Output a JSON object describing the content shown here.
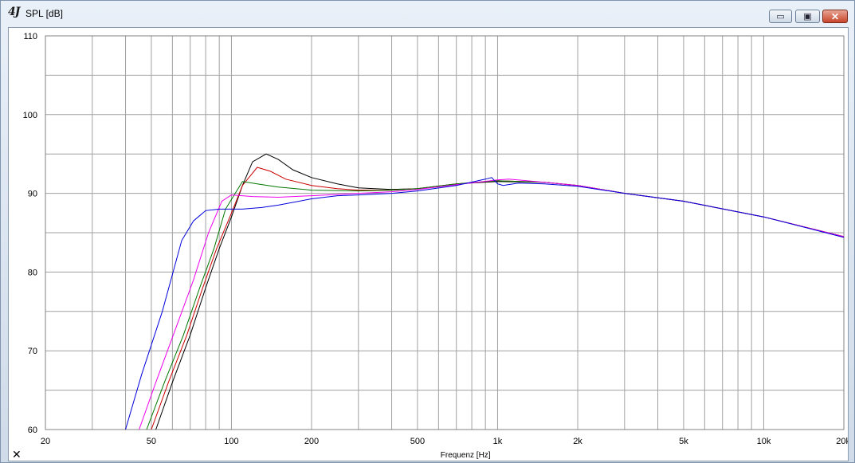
{
  "window": {
    "title": "SPL [dB]",
    "icon_glyph": "4J",
    "minimize_glyph": "▭",
    "maximize_glyph": "▣",
    "close_glyph": "✕"
  },
  "corner_glyph": "✕",
  "chart_data": {
    "type": "line",
    "xscale": "log",
    "xlim": [
      20,
      20000
    ],
    "ylim": [
      60,
      110
    ],
    "xlabel": "Frequenz [Hz]",
    "ylabel": "",
    "x_major_ticks": [
      {
        "value": 20,
        "label": "20"
      },
      {
        "value": 50,
        "label": "50"
      },
      {
        "value": 100,
        "label": "100"
      },
      {
        "value": 200,
        "label": "200"
      },
      {
        "value": 500,
        "label": "500"
      },
      {
        "value": 1000,
        "label": "1k"
      },
      {
        "value": 2000,
        "label": "2k"
      },
      {
        "value": 5000,
        "label": "5k"
      },
      {
        "value": 10000,
        "label": "10k"
      },
      {
        "value": 20000,
        "label": "20k"
      }
    ],
    "y_ticks": [
      {
        "value": 60,
        "label": "60"
      },
      {
        "value": 70,
        "label": "70"
      },
      {
        "value": 80,
        "label": "80"
      },
      {
        "value": 90,
        "label": "90"
      },
      {
        "value": 100,
        "label": "100"
      },
      {
        "value": 110,
        "label": "110"
      }
    ],
    "grid": true,
    "series": [
      {
        "color": "#000000",
        "points": [
          [
            52,
            60
          ],
          [
            60,
            66
          ],
          [
            70,
            72
          ],
          [
            80,
            78
          ],
          [
            90,
            83
          ],
          [
            100,
            87
          ],
          [
            110,
            91
          ],
          [
            120,
            94
          ],
          [
            135,
            95
          ],
          [
            150,
            94.3
          ],
          [
            170,
            93
          ],
          [
            200,
            92
          ],
          [
            250,
            91.2
          ],
          [
            300,
            90.7
          ],
          [
            400,
            90.5
          ],
          [
            500,
            90.6
          ],
          [
            700,
            91.2
          ],
          [
            1000,
            91.5
          ],
          [
            1500,
            91.4
          ],
          [
            2000,
            91.0
          ],
          [
            3000,
            90.0
          ],
          [
            5000,
            89.0
          ],
          [
            10000,
            87.0
          ],
          [
            20000,
            84.5
          ]
        ]
      },
      {
        "color": "#cc0000",
        "points": [
          [
            50,
            60
          ],
          [
            58,
            66
          ],
          [
            68,
            72
          ],
          [
            78,
            78
          ],
          [
            88,
            83
          ],
          [
            100,
            87.5
          ],
          [
            110,
            91
          ],
          [
            125,
            93.3
          ],
          [
            140,
            92.8
          ],
          [
            160,
            91.8
          ],
          [
            200,
            91.0
          ],
          [
            250,
            90.6
          ],
          [
            300,
            90.4
          ],
          [
            400,
            90.4
          ],
          [
            500,
            90.6
          ],
          [
            700,
            91.2
          ],
          [
            1000,
            91.6
          ],
          [
            1500,
            91.4
          ],
          [
            2000,
            91.0
          ],
          [
            3000,
            90.0
          ],
          [
            5000,
            89.0
          ],
          [
            10000,
            87.0
          ],
          [
            20000,
            84.5
          ]
        ]
      },
      {
        "color": "#007700",
        "points": [
          [
            48,
            60
          ],
          [
            56,
            66
          ],
          [
            66,
            72
          ],
          [
            76,
            78
          ],
          [
            86,
            83
          ],
          [
            95,
            88
          ],
          [
            110,
            91.5
          ],
          [
            125,
            91.2
          ],
          [
            150,
            90.8
          ],
          [
            200,
            90.4
          ],
          [
            300,
            90.3
          ],
          [
            400,
            90.4
          ],
          [
            500,
            90.6
          ],
          [
            700,
            91.2
          ],
          [
            1000,
            91.6
          ],
          [
            1500,
            91.4
          ],
          [
            2000,
            91.0
          ],
          [
            3000,
            90.0
          ],
          [
            5000,
            89.0
          ],
          [
            10000,
            87.0
          ],
          [
            20000,
            84.5
          ]
        ]
      },
      {
        "color": "#ee00ee",
        "points": [
          [
            45,
            60
          ],
          [
            52,
            66
          ],
          [
            62,
            73
          ],
          [
            72,
            79
          ],
          [
            82,
            85
          ],
          [
            92,
            89
          ],
          [
            100,
            89.8
          ],
          [
            120,
            89.6
          ],
          [
            150,
            89.5
          ],
          [
            200,
            89.7
          ],
          [
            300,
            90.0
          ],
          [
            400,
            90.2
          ],
          [
            500,
            90.5
          ],
          [
            700,
            91.1
          ],
          [
            1000,
            91.7
          ],
          [
            1100,
            91.8
          ],
          [
            1500,
            91.4
          ],
          [
            2000,
            91.0
          ],
          [
            3000,
            90.0
          ],
          [
            5000,
            89.0
          ],
          [
            10000,
            87.0
          ],
          [
            20000,
            84.5
          ]
        ]
      },
      {
        "color": "#0000dd",
        "points": [
          [
            40,
            60
          ],
          [
            46,
            67
          ],
          [
            55,
            75
          ],
          [
            65,
            84
          ],
          [
            72,
            86.5
          ],
          [
            80,
            87.8
          ],
          [
            90,
            88.0
          ],
          [
            110,
            88.0
          ],
          [
            130,
            88.2
          ],
          [
            150,
            88.5
          ],
          [
            200,
            89.3
          ],
          [
            250,
            89.7
          ],
          [
            300,
            89.8
          ],
          [
            400,
            90.0
          ],
          [
            500,
            90.3
          ],
          [
            700,
            91.0
          ],
          [
            900,
            91.8
          ],
          [
            950,
            92.0
          ],
          [
            1000,
            91.2
          ],
          [
            1050,
            91.0
          ],
          [
            1200,
            91.3
          ],
          [
            1500,
            91.2
          ],
          [
            2000,
            90.9
          ],
          [
            3000,
            90.0
          ],
          [
            5000,
            89.0
          ],
          [
            10000,
            87.0
          ],
          [
            20000,
            84.4
          ]
        ]
      }
    ]
  }
}
